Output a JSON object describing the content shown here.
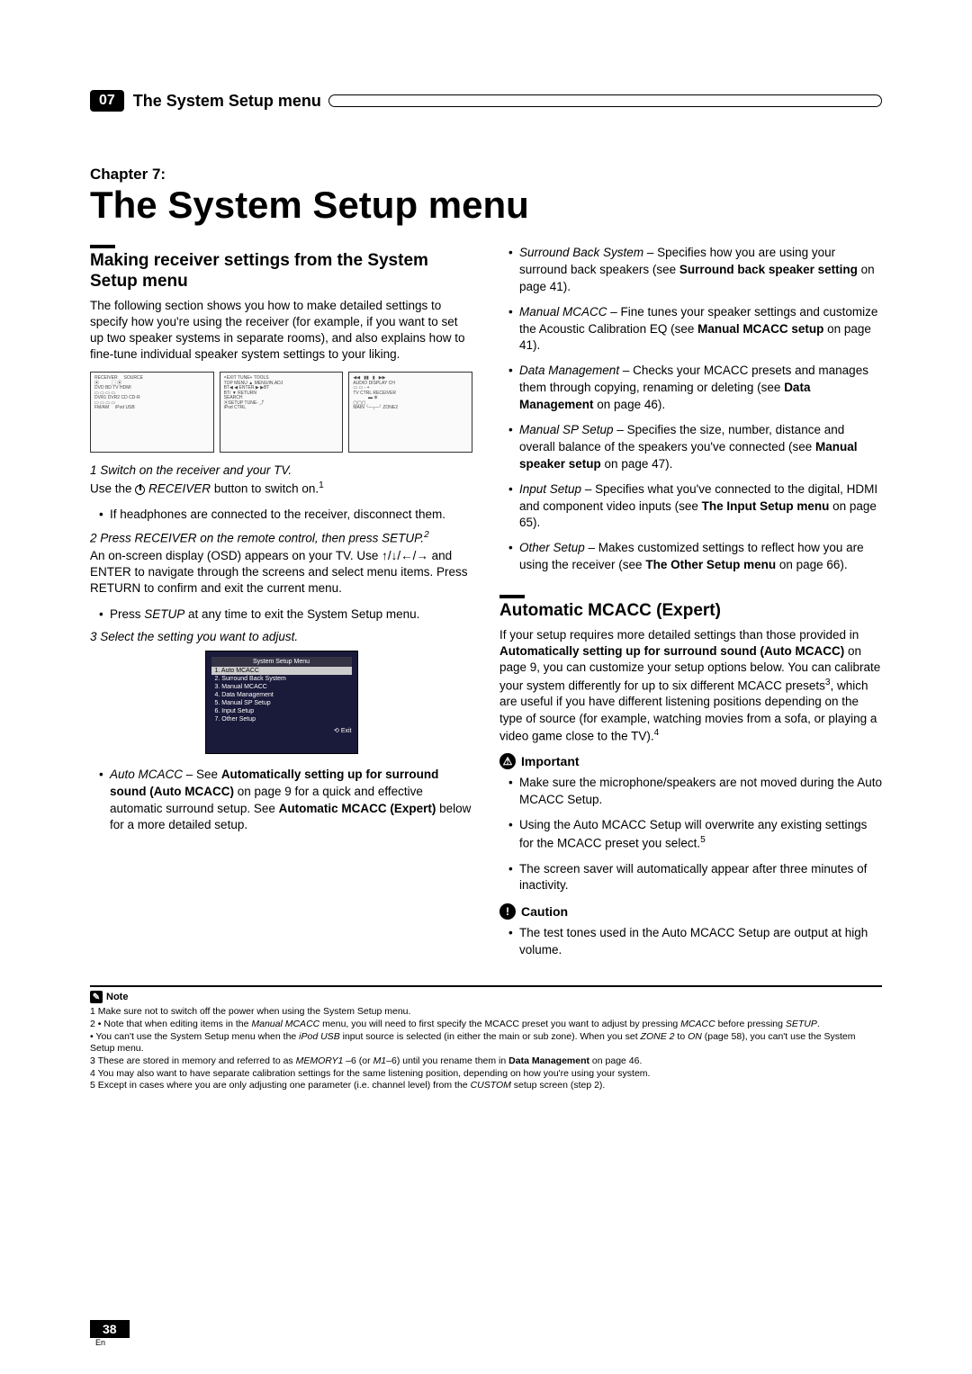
{
  "header": {
    "chapterNumber": "07",
    "chapterTitle": "The System Setup menu"
  },
  "title": {
    "chapterLabel": "Chapter 7:",
    "mainTitle": "The System Setup menu"
  },
  "left": {
    "sectionTitle": "Making receiver settings from the System Setup menu",
    "intro": "The following section shows you how to make detailed settings to specify how you're using the receiver (for example, if you want to set up two speaker systems in separate rooms), and also explains how to fine-tune individual speaker system settings to your liking.",
    "step1": "1   Switch on the receiver and your TV.",
    "step1text_a": "Use the ",
    "step1text_b": " RECEIVER",
    "step1text_c": " button to switch on.",
    "step1bullet": "If headphones are connected to the receiver, disconnect them.",
    "step2": "2   Press  RECEIVER  on the remote control, then press SETUP.",
    "step2text": "An on-screen display (OSD) appears on your TV. Use ↑/↓/←/→ and ENTER to navigate through the screens and select menu items. Press RETURN to confirm and exit the current menu.",
    "step2bullet_a": "Press ",
    "step2bullet_b": "SETUP",
    "step2bullet_c": " at any time to exit the System Setup menu.",
    "step3": "3   Select the setting you want to adjust.",
    "menu": {
      "title": "System Setup Menu",
      "items": [
        "1. Auto MCACC",
        "2. Surround Back System",
        "3. Manual MCACC",
        "4. Data Management",
        "5. Manual SP Setup",
        "6. Input Setup",
        "7. Other Setup"
      ],
      "exit": "⟲ Exit"
    },
    "autoMcacc_label": "Auto MCACC",
    "autoMcacc_a": " – See ",
    "autoMcacc_b": "Automatically setting up for surround sound (Auto MCACC)",
    "autoMcacc_c": " on page 9 for a quick and effective automatic surround setup. See ",
    "autoMcacc_d": "Automatic MCACC (Expert)",
    "autoMcacc_e": " below for a more detailed setup."
  },
  "right": {
    "surroundBack_label": "Surround Back System",
    "surroundBack_a": " – Specifies how you are using your surround back speakers (see ",
    "surroundBack_b": "Surround back speaker setting",
    "surroundBack_c": " on page 41).",
    "manualMcacc_label": "Manual MCACC",
    "manualMcacc_a": " – Fine tunes your speaker settings and customize the Acoustic Calibration EQ (see ",
    "manualMcacc_b": "Manual MCACC setup",
    "manualMcacc_c": " on page 41).",
    "dataMgmt_label": "Data Management",
    "dataMgmt_a": " – Checks your MCACC presets and manages them through copying, renaming or deleting (see ",
    "dataMgmt_b": "Data Management",
    "dataMgmt_c": " on page 46).",
    "manualSp_label": "Manual SP Setup",
    "manualSp_a": " – Specifies the size, number, distance and overall balance of the speakers you've connected (see ",
    "manualSp_b": "Manual speaker setup",
    "manualSp_c": " on page 47).",
    "inputSetup_label": "Input Setup",
    "inputSetup_a": " – Specifies what you've connected to the digital, HDMI and component video inputs (see ",
    "inputSetup_b": "The Input Setup menu",
    "inputSetup_c": " on page 65).",
    "otherSetup_label": "Other Setup",
    "otherSetup_a": " – Makes customized settings to reflect how you are using the receiver (see ",
    "otherSetup_b": "The Other Setup menu",
    "otherSetup_c": " on page 66).",
    "section2Title": "Automatic MCACC (Expert)",
    "section2text_a": "If your setup requires more detailed settings than those provided in ",
    "section2text_b": "Automatically setting up for surround sound (Auto MCACC)",
    "section2text_c": " on page 9, you can customize your setup options below. You can calibrate your system differently for up to six different MCACC presets",
    "section2text_d": ", which are useful if you have different listening positions depending on the type of source (for example, watching movies from a sofa, or playing a video game close to the TV).",
    "importantLabel": "Important",
    "imp1": "Make sure the microphone/speakers are not moved during the Auto MCACC Setup.",
    "imp2": "Using the Auto MCACC Setup will overwrite any existing settings for the MCACC preset you select.",
    "imp3": "The screen saver will automatically appear after three minutes of inactivity.",
    "cautionLabel": "Caution",
    "caution1": "The test tones used in the Auto MCACC Setup are output at high volume."
  },
  "footnotes": {
    "noteLabel": "Note",
    "n1": "1 Make sure not to switch off the power when using the System Setup menu.",
    "n2a": "2 • Note that when editing items in the ",
    "n2a_i": "Manual MCACC",
    "n2b": " menu, you will need to first specify the MCACC preset you want to adjust by pressing ",
    "n2b_i": "MCACC",
    "n2c": " before pressing ",
    "n2c_i": "SETUP",
    "n2d": ".",
    "n2e_a": "   • You can't use the System Setup menu when the ",
    "n2e_i": "iPod USB",
    "n2e_b": " input source is selected (in either the main or sub zone). When you set ",
    "n2e_i2": "ZONE 2",
    "n2e_c": " to ",
    "n2e_i3": "ON",
    "n2e_d": " (page 58), you can't use the System Setup menu.",
    "n3a": "3 These are stored in memory and referred to as ",
    "n3a_i": "MEMORY1",
    "n3b": " –6 (or ",
    "n3b_i": "M1",
    "n3c": "–6) until you rename them in ",
    "n3c_b": "Data Management",
    "n3d": " on page 46.",
    "n4": "4 You may also want to have separate calibration settings for the same listening position, depending on how you're using your system.",
    "n5a": "5 Except in cases where you are only adjusting one parameter (i.e. channel level) from the ",
    "n5a_i": "CUSTOM",
    "n5b": " setup screen (step 2)."
  },
  "pageNum": {
    "number": "38",
    "label": "En"
  }
}
